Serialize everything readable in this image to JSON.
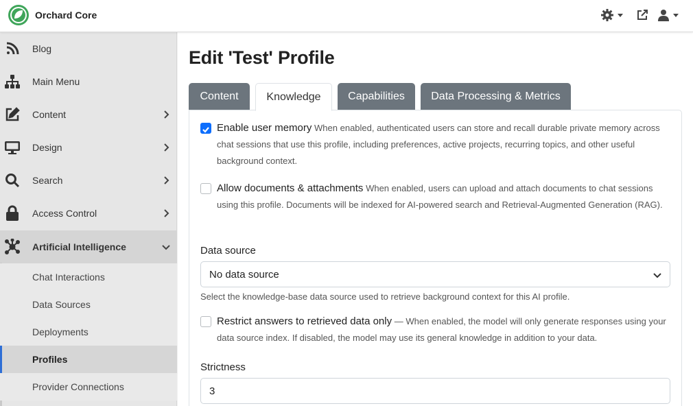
{
  "app": {
    "brand": "Orchard Core",
    "brand_color": "#3fa55a"
  },
  "topbar": {
    "icons": [
      "gear-icon",
      "external-link-icon",
      "user-icon"
    ]
  },
  "sidebar": {
    "items": [
      {
        "label": "Blog",
        "icon": "rss-icon"
      },
      {
        "label": "Main Menu",
        "icon": "sitemap-icon"
      },
      {
        "label": "Content",
        "icon": "edit-icon"
      },
      {
        "label": "Design",
        "icon": "monitor-icon"
      },
      {
        "label": "Search",
        "icon": "search-icon"
      },
      {
        "label": "Access Control",
        "icon": "lock-icon"
      },
      {
        "label": "Artificial Intelligence",
        "icon": "network-icon"
      }
    ],
    "subitems": [
      {
        "label": "Chat Interactions"
      },
      {
        "label": "Data Sources"
      },
      {
        "label": "Deployments"
      },
      {
        "label": "Profiles"
      },
      {
        "label": "Provider Connections"
      }
    ],
    "active_color": "#2f6fd6"
  },
  "page": {
    "title": "Edit 'Test' Profile"
  },
  "tabs": [
    {
      "label": "Content"
    },
    {
      "label": "Knowledge"
    },
    {
      "label": "Capabilities"
    },
    {
      "label": "Data Processing & Metrics"
    }
  ],
  "knowledge": {
    "memory": {
      "label": "Enable user memory",
      "checked": true,
      "help": "When enabled, authenticated users can store and recall durable private memory across chat sessions that use this profile, including preferences, active projects, recurring topics, and other useful background context."
    },
    "documents": {
      "label": "Allow documents & attachments",
      "checked": false,
      "help": "When enabled, users can upload and attach documents to chat sessions using this profile. Documents will be indexed for AI-powered search and Retrieval-Augmented Generation (RAG)."
    },
    "data_source": {
      "label": "Data source",
      "value": "No data source",
      "help": "Select the knowledge-base data source used to retrieve background context for this AI profile."
    },
    "restrict": {
      "label": "Restrict answers to retrieved data only",
      "checked": false,
      "help": "— When enabled, the model will only generate responses using your data source index. If disabled, the model may use its general knowledge in addition to your data."
    },
    "strictness": {
      "label": "Strictness",
      "value": "3"
    }
  }
}
